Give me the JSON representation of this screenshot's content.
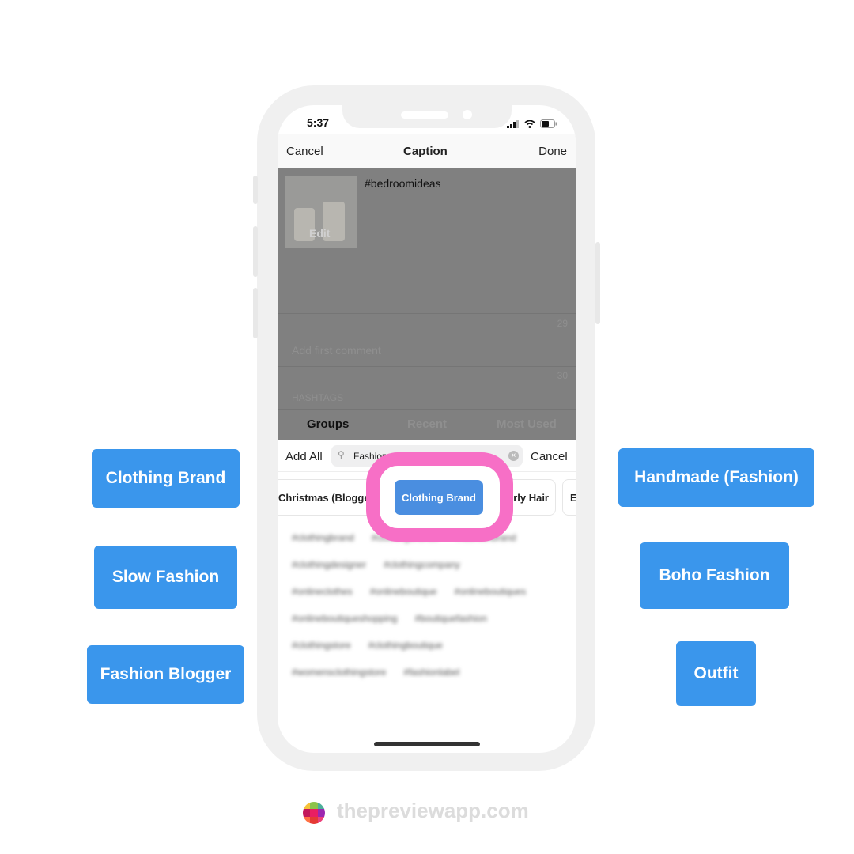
{
  "status_bar": {
    "time": "5:37"
  },
  "nav": {
    "cancel": "Cancel",
    "title": "Caption",
    "done": "Done"
  },
  "post": {
    "caption": "#bedroomideas",
    "thumb_edit": "Edit",
    "caption_count": "29",
    "comment_placeholder": "Add first comment",
    "comment_count": "30",
    "hashtags_header": "HASHTAGS"
  },
  "tabs": [
    "Groups",
    "Recent",
    "Most Used"
  ],
  "search_row": {
    "add_all": "Add All",
    "search_value": "Fashion",
    "cancel": "Cancel"
  },
  "chips": [
    "Christmas (Blogger)",
    "Clothing Brand",
    "Curly Hair",
    "E"
  ],
  "hashtags": [
    [
      "#clothingbrand",
      "#clothingbrands",
      "#fashionbrand"
    ],
    [
      "#clothingdesigner",
      "#clothingcompany"
    ],
    [
      "#onlineclothes",
      "#onlineboutique",
      "#onlineboutiques"
    ],
    [
      "#onlineboutiqueshopping",
      "#boutiquefashion"
    ],
    [
      "#clothingstore",
      "#clothingboutique"
    ],
    [
      "#womensclothingstore",
      "#fashionlabel"
    ]
  ],
  "labels_left": [
    "Clothing Brand",
    "Slow Fashion",
    "Fashion Blogger"
  ],
  "labels_right": [
    "Handmade (Fashion)",
    "Boho Fashion",
    "Outfit"
  ],
  "brand": "thepreviewapp.com",
  "colors": {
    "label_blue": "#3a96ec",
    "highlight_pink": "#f76fc6",
    "selected_chip": "#4a8ee0"
  }
}
